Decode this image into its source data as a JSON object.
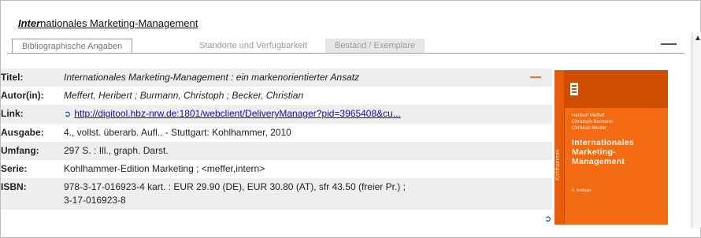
{
  "record_title_prefix": "Inter",
  "record_title_rest": "nationales Marketing-Management",
  "tabs": [
    {
      "label": "Bibliographische Angaben"
    },
    {
      "label": "Standorte und Verfügbarkeit"
    },
    {
      "label": "Bestand / Exemplare"
    }
  ],
  "fields": [
    {
      "label": "Titel:",
      "value": "Internationales Marketing-Management : ein markenorientierter Ansatz",
      "italic": true
    },
    {
      "label": "Autor(in):",
      "value": "Meffert, Heribert ; Burmann, Christoph ; Becker, Christian",
      "italic": true
    },
    {
      "label": "Link:",
      "value": "http://digitool.hbz-nrw.de:1801/webclient/DeliveryManager?pid=3965408&cu..."
    },
    {
      "label": "Ausgabe:",
      "value": "4., vollst. überarb. Aufl.. - Stuttgart: Kohlhammer, 2010"
    },
    {
      "label": "Umfang:",
      "value": "297 S. : Ill., graph. Darst."
    },
    {
      "label": "Serie:",
      "value": "Kohlhammer-Edition Marketing ; <meffer,intern>"
    },
    {
      "label": "ISBN:",
      "value": "978-3-17-016923-4 kart. : EUR 29.90 (DE), EUR 30.80 (AT), sfr 43.50 (freier Pr.) ;",
      "value2": "3-17-016923-8"
    }
  ],
  "cover": {
    "authors": [
      "Heribert Meffert",
      "Christoph Burmann",
      "Christian Becker"
    ],
    "title_lines": [
      "Internationales",
      "Marketing-",
      "Management"
    ],
    "edition": "4. Auflage",
    "spine": "Kohlhammer"
  },
  "icons": {
    "external_link": "external-link-icon",
    "minimize": "minimize-icon"
  },
  "colors": {
    "cover_orange": "#f26a11",
    "row_stripe": "#eeeeee",
    "link": "#1a0dab"
  }
}
